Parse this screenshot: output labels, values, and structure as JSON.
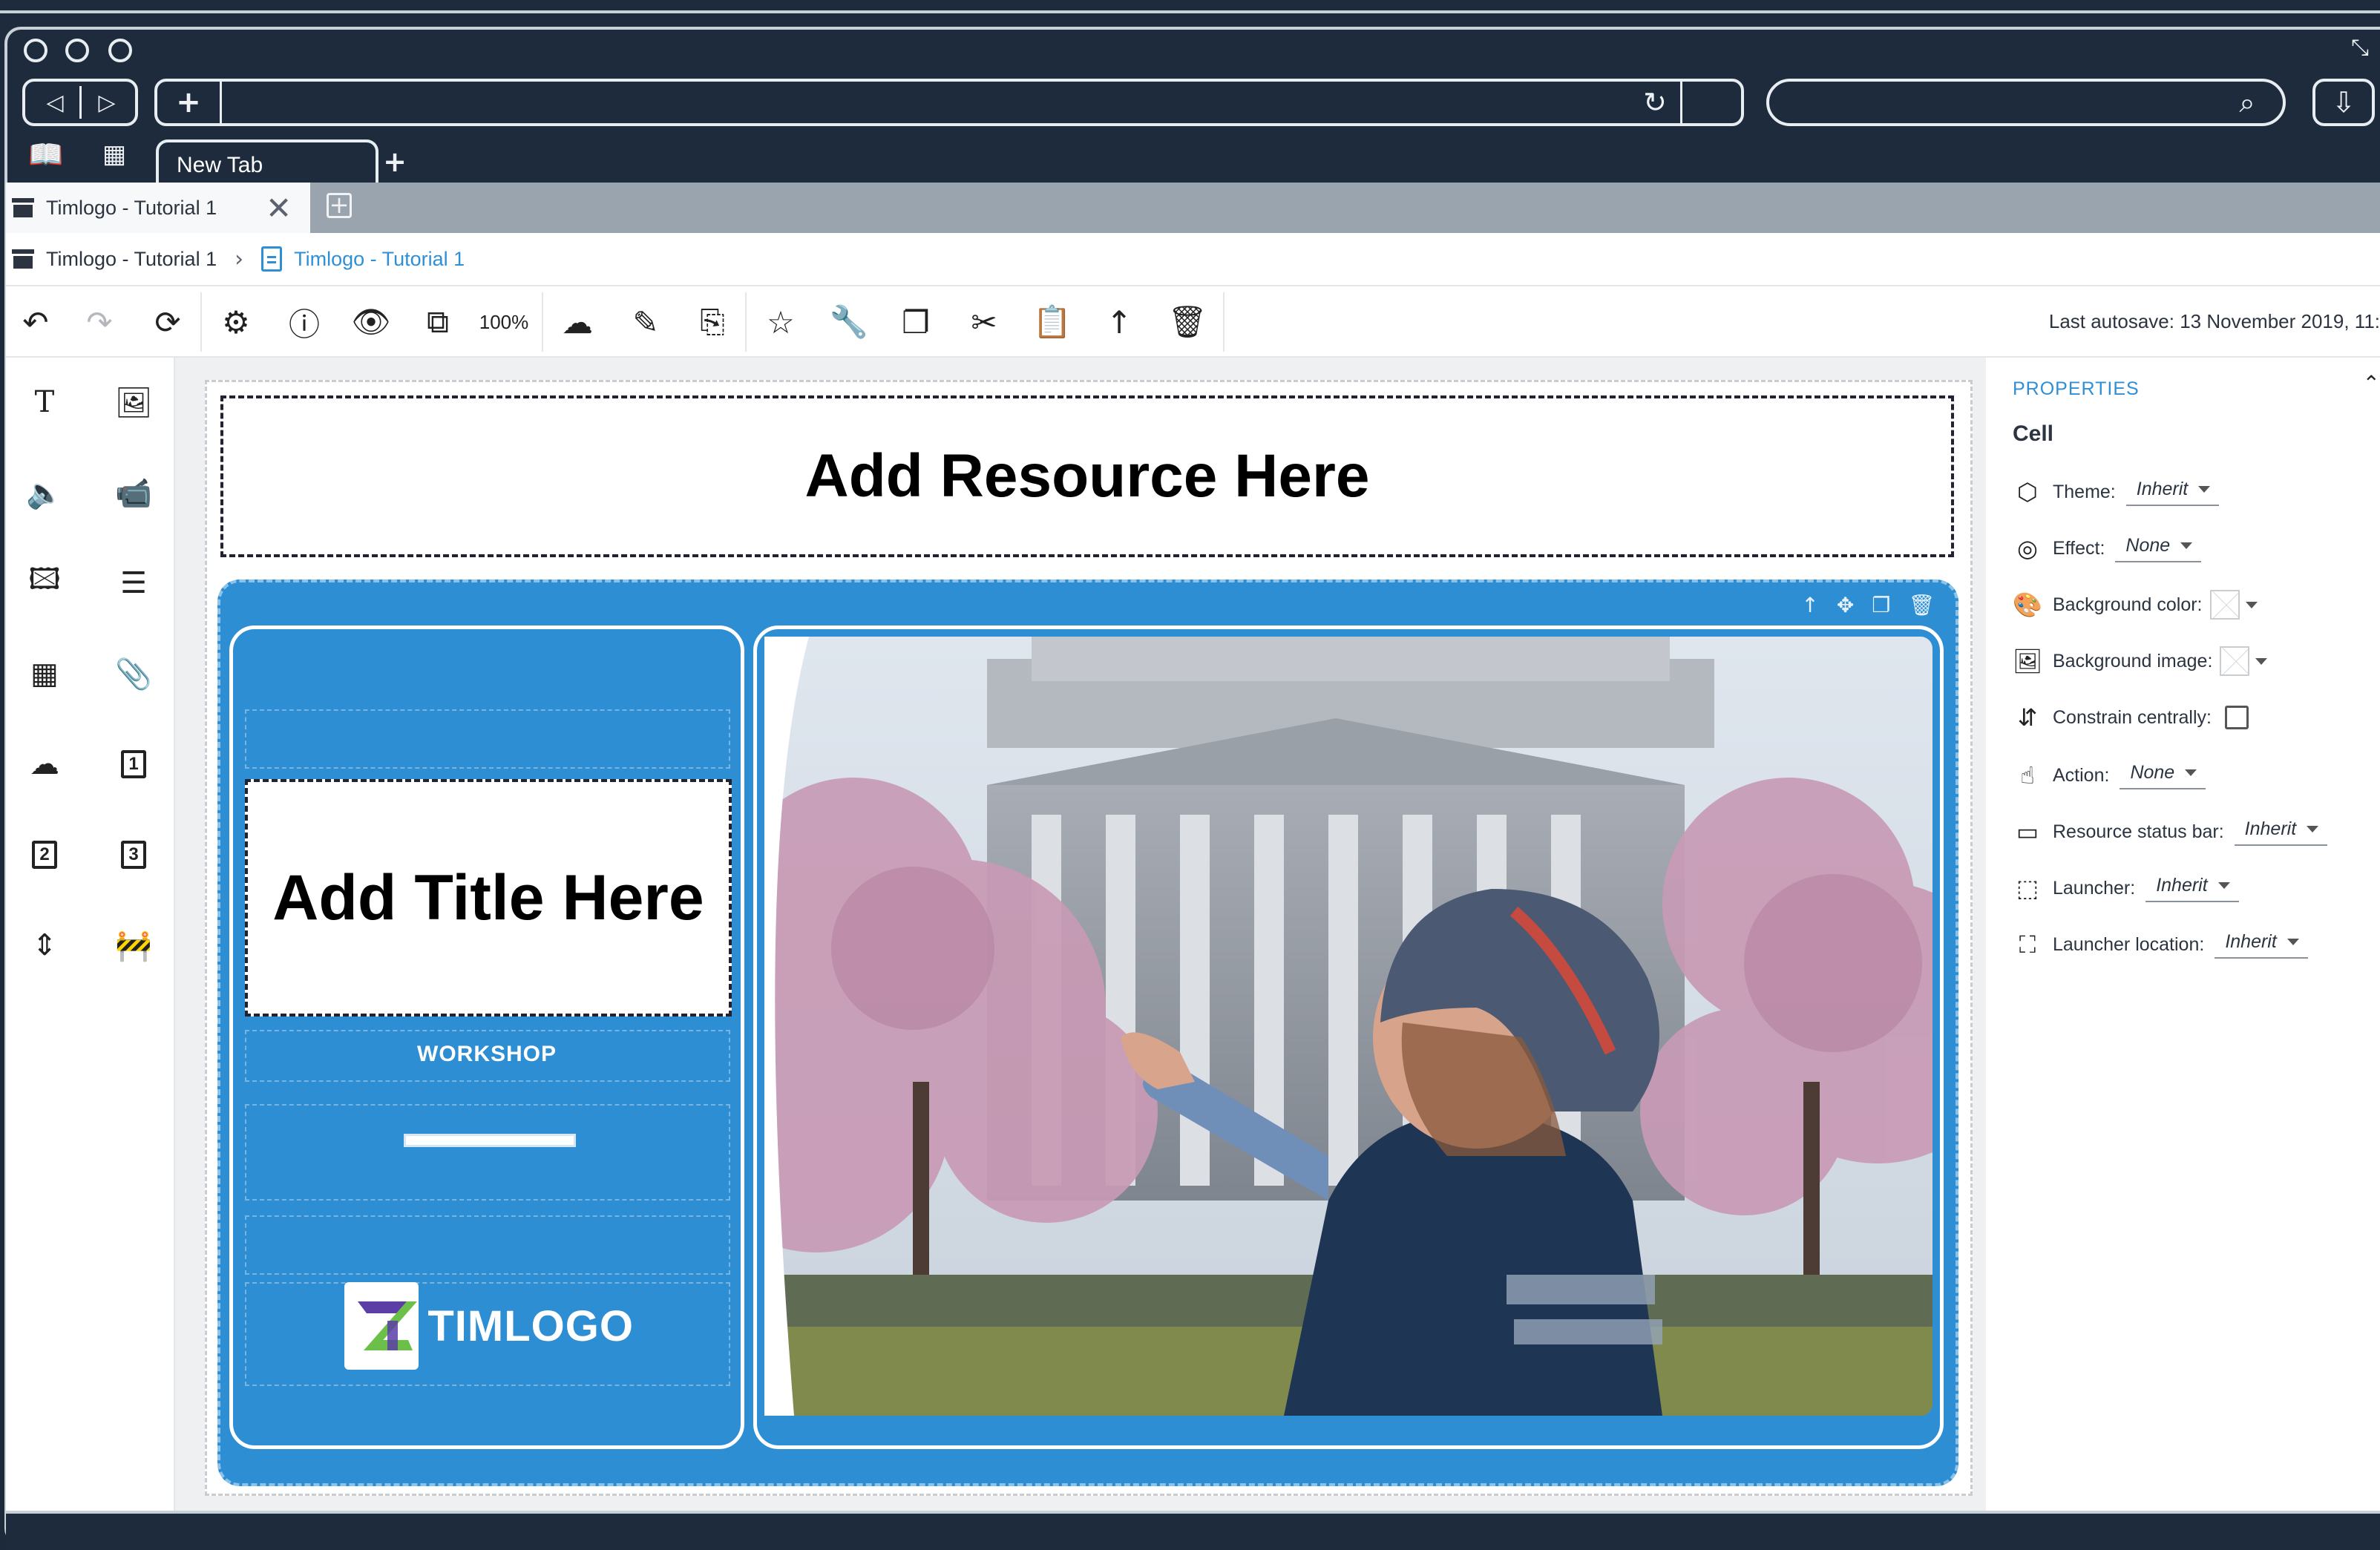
{
  "browser": {
    "new_tab_label": "New Tab",
    "icons": [
      "back-icon",
      "forward-icon",
      "plus-icon",
      "reload-icon",
      "search-icon",
      "download-icon",
      "bookmarks-icon",
      "apps-grid-icon",
      "fullscreen-icon"
    ]
  },
  "app": {
    "tab": {
      "label": "Timlogo - Tutorial 1"
    },
    "breadcrumb": {
      "root": "Timlogo - Tutorial 1",
      "current": "Timlogo - Tutorial 1"
    },
    "toolbar": {
      "zoom": "100%",
      "autosave": "Last autosave: 13 November 2019, 11:"
    },
    "left_panel_numbers": {
      "one": "1",
      "two": "2",
      "three": "3"
    },
    "canvas": {
      "resource_placeholder": "Add Resource Here",
      "title_placeholder": "Add Title Here",
      "workshop_label": "WORKSHOP",
      "logo_text": "TIMLOGO"
    },
    "properties": {
      "heading": "PROPERTIES",
      "section": "Cell",
      "rows": {
        "theme": {
          "label": "Theme:",
          "value": "Inherit"
        },
        "effect": {
          "label": "Effect:",
          "value": "None"
        },
        "bg_color": {
          "label": "Background color:"
        },
        "bg_image": {
          "label": "Background image:"
        },
        "constrain": {
          "label": "Constrain centrally:"
        },
        "action": {
          "label": "Action:",
          "value": "None"
        },
        "status_bar": {
          "label": "Resource status bar:",
          "value": "Inherit"
        },
        "launcher": {
          "label": "Launcher:",
          "value": "Inherit"
        },
        "launcher_location": {
          "label": "Launcher location:",
          "value": "Inherit"
        }
      }
    }
  },
  "colors": {
    "accent_blue": "#2f8fd6",
    "cell_blue": "#2d8ed3",
    "chrome_dark": "#1d2b3c",
    "logo_green": "#6cc04a",
    "logo_purple": "#5b3ea6"
  }
}
